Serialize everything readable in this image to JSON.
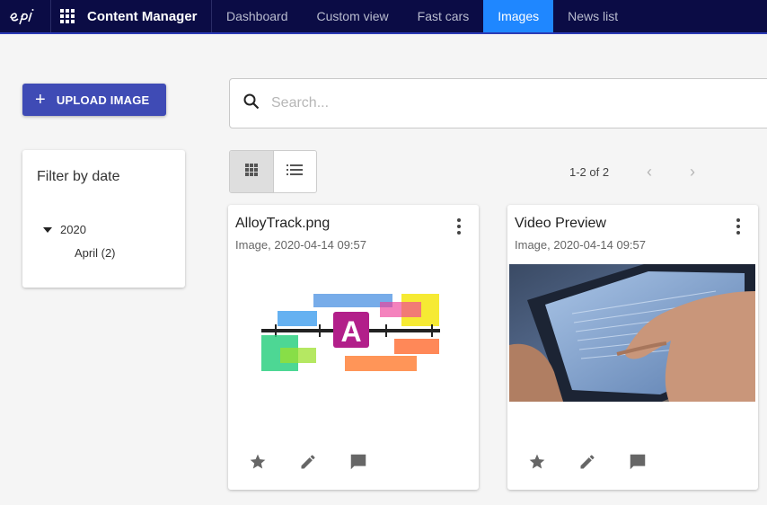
{
  "header": {
    "app_title": "Content Manager",
    "tabs": [
      {
        "label": "Dashboard",
        "active": false
      },
      {
        "label": "Custom view",
        "active": false
      },
      {
        "label": "Fast cars",
        "active": false
      },
      {
        "label": "Images",
        "active": true
      },
      {
        "label": "News list",
        "active": false
      }
    ],
    "logo_icon": "episerver-logo",
    "accent_color": "#1f87ff",
    "bar_color": "#0b0c45"
  },
  "upload": {
    "label": "UPLOAD IMAGE",
    "icon": "plus-icon",
    "color": "#3f4bb5"
  },
  "filter": {
    "title": "Filter by date",
    "year": "2020",
    "month": "April (2)"
  },
  "search": {
    "placeholder": "Search...",
    "value": ""
  },
  "view_toggle": {
    "selected": "grid",
    "options": [
      "grid",
      "list"
    ]
  },
  "pagination": {
    "label": "1-2 of 2"
  },
  "cards": [
    {
      "title": "AlloyTrack.png",
      "meta": "Image, 2020-04-14 09:57",
      "thumbnail": "alloy-track-illustration",
      "thumbnail_letter": "A"
    },
    {
      "title": "Video Preview",
      "meta": "Image, 2020-04-14 09:57",
      "thumbnail": "tablet-touch-photo"
    }
  ],
  "card_actions": [
    "star-icon",
    "edit-icon",
    "comment-icon"
  ]
}
